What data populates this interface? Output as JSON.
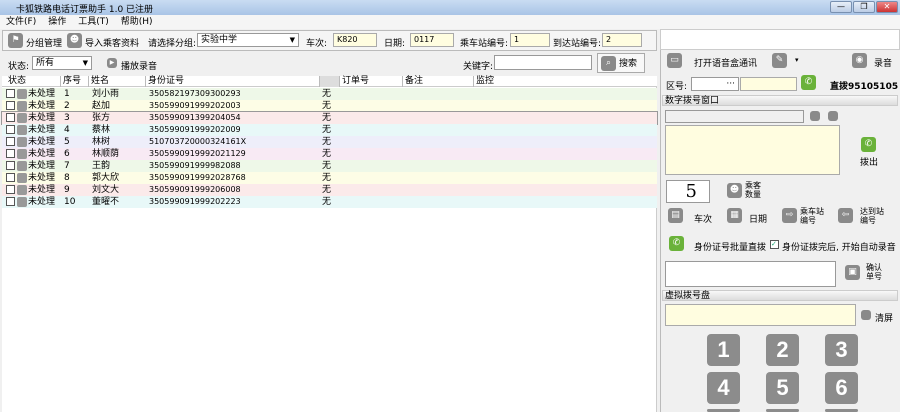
{
  "window": {
    "title": "卡狐铁路电话订票助手 1.0 已注册",
    "min": "—",
    "max": "❐",
    "close": "✕"
  },
  "menu": [
    "文件(F)",
    "操作",
    "工具(T)",
    "帮助(H)"
  ],
  "toolbar": {
    "group_manage": "分组管理",
    "import": "导入乘客资料",
    "group_label": "请选择分组:",
    "group_value": "实验中学",
    "train_label": "车次:",
    "train_value": "K820",
    "date_label": "日期:",
    "date_value": "0117",
    "from_label": "乘车站编号:",
    "from_value": "1",
    "to_label": "到达站编号:",
    "to_value": "2"
  },
  "filter": {
    "status_label": "状态:",
    "status_value": "所有",
    "play": "播放录音",
    "keyword_label": "关键字:",
    "keyword_value": "",
    "search": "搜索"
  },
  "table": {
    "headers": [
      "状态",
      "序号",
      "姓名",
      "身份证号",
      "订单号",
      "备注",
      "监控"
    ],
    "rows": [
      {
        "status": "未处理",
        "no": "1",
        "name": "刘小雨",
        "id": "350582197309300293",
        "order": "无"
      },
      {
        "status": "未处理",
        "no": "2",
        "name": "赵加",
        "id": "350599091999202003",
        "order": "无"
      },
      {
        "status": "未处理",
        "no": "3",
        "name": "张方",
        "id": "350599091399204054",
        "order": "无"
      },
      {
        "status": "未处理",
        "no": "4",
        "name": "蔡林",
        "id": "350599091999202009",
        "order": "无"
      },
      {
        "status": "未处理",
        "no": "5",
        "name": "林树",
        "id": "51070372000032416​1X",
        "order": "无"
      },
      {
        "status": "未处理",
        "no": "6",
        "name": "林顺荫",
        "id": "3505990919992021129",
        "order": "无"
      },
      {
        "status": "未处理",
        "no": "7",
        "name": "王韵",
        "id": "350599091999982088",
        "order": "无"
      },
      {
        "status": "未处理",
        "no": "8",
        "name": "郭大欣",
        "id": "3505990919992028768",
        "order": "无"
      },
      {
        "status": "未处理",
        "no": "9",
        "name": "刘文大",
        "id": "350599091999206008",
        "order": "无"
      },
      {
        "status": "未处理",
        "no": "10",
        "name": "董曜不",
        "id": "350599091999202223",
        "order": "无"
      }
    ],
    "row_colors": [
      "#eef8e8",
      "#fdfde6",
      "#fbeaea",
      "#e8f8f8",
      "#eeeefa",
      "#f8eaf4",
      "#eef8e8",
      "#fdfde6",
      "#fbeaea",
      "#e8f8f8"
    ]
  },
  "right": {
    "open_voice": "打开语音盒通讯",
    "record": "录音",
    "area_label": "区号:",
    "area_dots": "···",
    "direct": "直拨95105105",
    "digit_window": "数字拨号窗口",
    "dial_out": "拨出",
    "count_value": "5",
    "passenger_count": "乘客数量",
    "train": "车次",
    "date": "日期",
    "from": "乘车站编号",
    "to": "达到站编号",
    "batch_dial": "身份证号批量直拨",
    "auto_record": "身份证拨完后, 开始自动录音",
    "confirm": "确认单号",
    "virtual_pad": "虚拟拨号盘",
    "clear": "清屏",
    "keys": [
      "1",
      "2",
      "3",
      "4",
      "5",
      "6"
    ]
  }
}
